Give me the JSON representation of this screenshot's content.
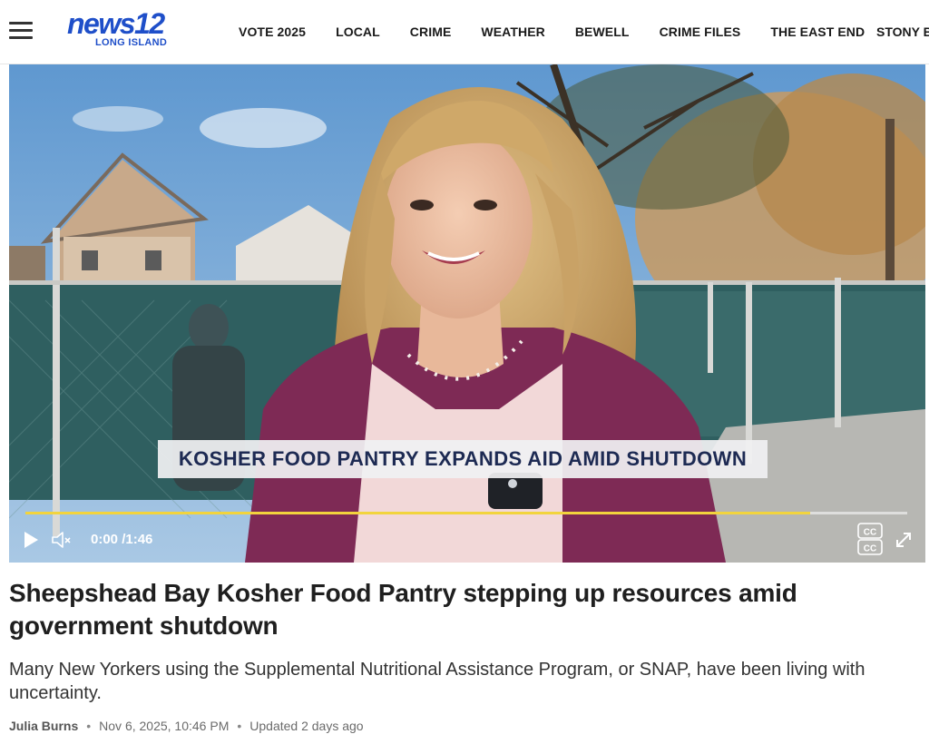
{
  "header": {
    "logo_main": "news12",
    "logo_sub": "LONG ISLAND",
    "nav_items": [
      "VOTE 2025",
      "LOCAL",
      "CRIME",
      "WEATHER",
      "BEWELL",
      "CRIME FILES",
      "THE EAST END"
    ],
    "nav_overflow": "STONY B"
  },
  "video": {
    "lower_third": "KOSHER FOOD PANTRY EXPANDS AID AMID SHUTDOWN",
    "current_time": "0:00",
    "duration": "1:46",
    "buffered_fraction": 0.89,
    "progress_color": "#f2d43d",
    "play_icon": "play-icon",
    "mute_icon": "muted-speaker-icon",
    "cc_label": "CC",
    "fullscreen_icon": "expand-icon"
  },
  "article": {
    "headline": "Sheepshead Bay Kosher Food Pantry stepping up resources amid government shutdown",
    "dek": "Many New Yorkers using the Supplemental Nutritional Assistance Program, or SNAP, have been living with uncertainty.",
    "author": "Julia Burns",
    "published": "Nov 6, 2025, 10:46 PM",
    "updated": "Updated 2 days ago"
  },
  "colors": {
    "brand_blue": "#1f4fc9",
    "lower_third_text": "#1d2a53"
  }
}
